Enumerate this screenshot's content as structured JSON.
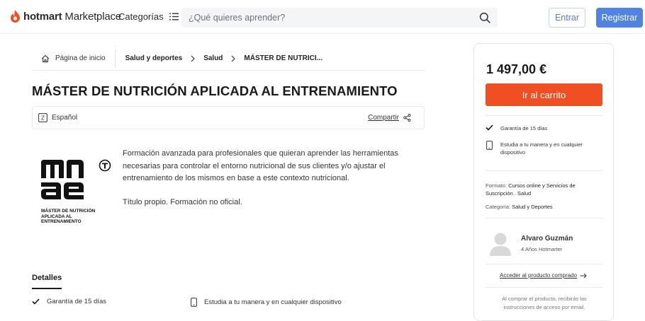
{
  "header": {
    "logo_brand": "hotmart",
    "logo_suffix": " Marketplace",
    "categories_label": "Categorías",
    "search_placeholder": "¿Qué quieres aprender?",
    "login_label": "Entrar",
    "register_label": "Registrar"
  },
  "breadcrumb": {
    "home": "Página de inicio",
    "items": [
      "Salud y deportes",
      "Salud",
      "MÁSTER DE NUTRICI..."
    ]
  },
  "product": {
    "title": "MÁSTER DE NUTRICIÓN APLICADA AL ENTRENAMIENTO",
    "language": "Español",
    "share_label": "Compartir",
    "logo_caption": "MÁSTER DE NUTRICIÓN APLICADA AL ENTRENAMIENTO",
    "description_1": "Formación avanzada para profesionales que quieran aprender las herramientas necesarias para controlar el entorno nutricional de sus clientes y/o ajustar el entrenamiento de los mismos en base a este contexto nutricional.",
    "description_2": "Título propio. Formación no oficial."
  },
  "details": {
    "tab_label": "Detalles",
    "guarantee": "Garantía de 15 días",
    "device": "Estudia a tu manera y en cualquier dispositivo"
  },
  "card": {
    "price": "1 497,00 €",
    "cart_label": "Ir al carrito",
    "feature_guarantee": "Garantía de 15 días",
    "feature_device": "Estudia a tu manera y en cualquier dispositivo",
    "format_label": "Formato: ",
    "format_value": "Cursos online y Servicios de Suscripción . Salud",
    "category_label": "Categoría: ",
    "category_value": "Salud y Deportes",
    "author_name": "Alvaro Guzmán",
    "author_sub": "4 Años Hotmarter",
    "access_link": "Acceder al producto comprado",
    "access_note": "Al comprar el producto, recibirás las instrucciones de acceso por email."
  },
  "colors": {
    "brand_orange": "#f04e23",
    "register_blue": "#5183e0"
  },
  "icons": [
    "hotmart-logo-icon",
    "list-icon",
    "search-icon",
    "home-icon",
    "chevron-right-icon",
    "language-icon",
    "share-icon",
    "check-icon",
    "mobile-icon",
    "avatar-icon",
    "arrow-right-icon"
  ]
}
